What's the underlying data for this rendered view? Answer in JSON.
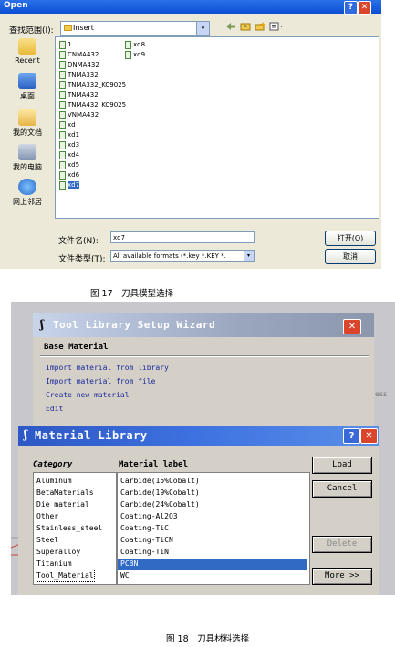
{
  "open_dialog": {
    "title": "Open",
    "help_glyph": "?",
    "close_glyph": "✕",
    "look_in_label": "查找范围(I):",
    "look_in_value": "Insert",
    "dropdown_glyph": "▾",
    "nav_icons": [
      "back-icon",
      "up-folder-icon",
      "new-folder-icon",
      "view-menu-icon"
    ],
    "places": [
      "Recent",
      "桌面",
      "我的文档",
      "我的电脑",
      "网上邻居"
    ],
    "files": [
      "1",
      "CNMA432",
      "DNMA432",
      "TNMA332",
      "TNMA332_KC9025",
      "TNMA432",
      "TNMA432_KC9025",
      "VNMA432",
      "xd",
      "xd1",
      "xd3",
      "xd4",
      "xd5",
      "xd6",
      "xd7",
      "xd8",
      "xd9"
    ],
    "selected_file": "xd7",
    "file_name_label": "文件名(N):",
    "file_name_value": "xd7",
    "file_type_label": "文件类型(T):",
    "file_type_value": "All available formats (*.key *.KEY *.",
    "open_button": "打开(O)",
    "cancel_button": "取消"
  },
  "captions": {
    "fig17": "图 17　刀具模型选择",
    "fig18": "图 18　刀具材料选择"
  },
  "wizard": {
    "logo": "ʃ",
    "title": "Tool Library Setup Wizard",
    "close_glyph": "✕",
    "heading": "Base Material",
    "options": [
      "Import material from library",
      "Import material from file",
      "Create new material",
      "Edit"
    ],
    "partial_text": "ess"
  },
  "material_library": {
    "logo": "ʃ",
    "title": "Material Library",
    "help_glyph": "?",
    "close_glyph": "✕",
    "category_header": "Category",
    "material_header": "Material label",
    "categories": [
      "Aluminum",
      "BetaMaterials",
      "Die_material",
      "Other",
      "Stainless_steel",
      "Steel",
      "Superalloy",
      "Titanium",
      "Tool_Material"
    ],
    "selected_category": "Tool_Material",
    "materials": [
      "Carbide(15%Cobalt)",
      "Carbide(19%Cobalt)",
      "Carbide(24%Cobalt)",
      "Coating-Al2O3",
      "Coating-TiC",
      "Coating-TiCN",
      "Coating-TiN",
      "PCBN",
      "WC"
    ],
    "selected_material": "PCBN",
    "buttons": {
      "load": "Load",
      "cancel": "Cancel",
      "delete": "Delete",
      "more": "More >>"
    }
  }
}
